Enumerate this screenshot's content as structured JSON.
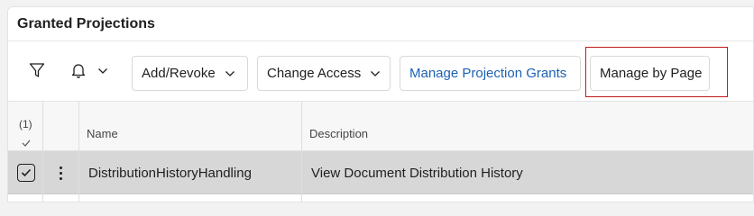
{
  "panel": {
    "title": "Granted Projections"
  },
  "toolbar": {
    "filter_icon": "filter-icon",
    "notification_icon": "bell-icon",
    "buttons": {
      "add_revoke": "Add/Revoke",
      "change_access": "Change Access",
      "manage_projection_grants": "Manage Projection Grants",
      "manage_by_page": "Manage by Page"
    },
    "link_color": "#1d61b5",
    "highlight_color": "#c21a1a"
  },
  "grid": {
    "selected_count": "(1)",
    "columns": [
      "Name",
      "Description"
    ],
    "rows": [
      {
        "selected": true,
        "name": "DistributionHistoryHandling",
        "description": "View Document Distribution History"
      }
    ],
    "selected_row_color": "#d7d7d7"
  }
}
